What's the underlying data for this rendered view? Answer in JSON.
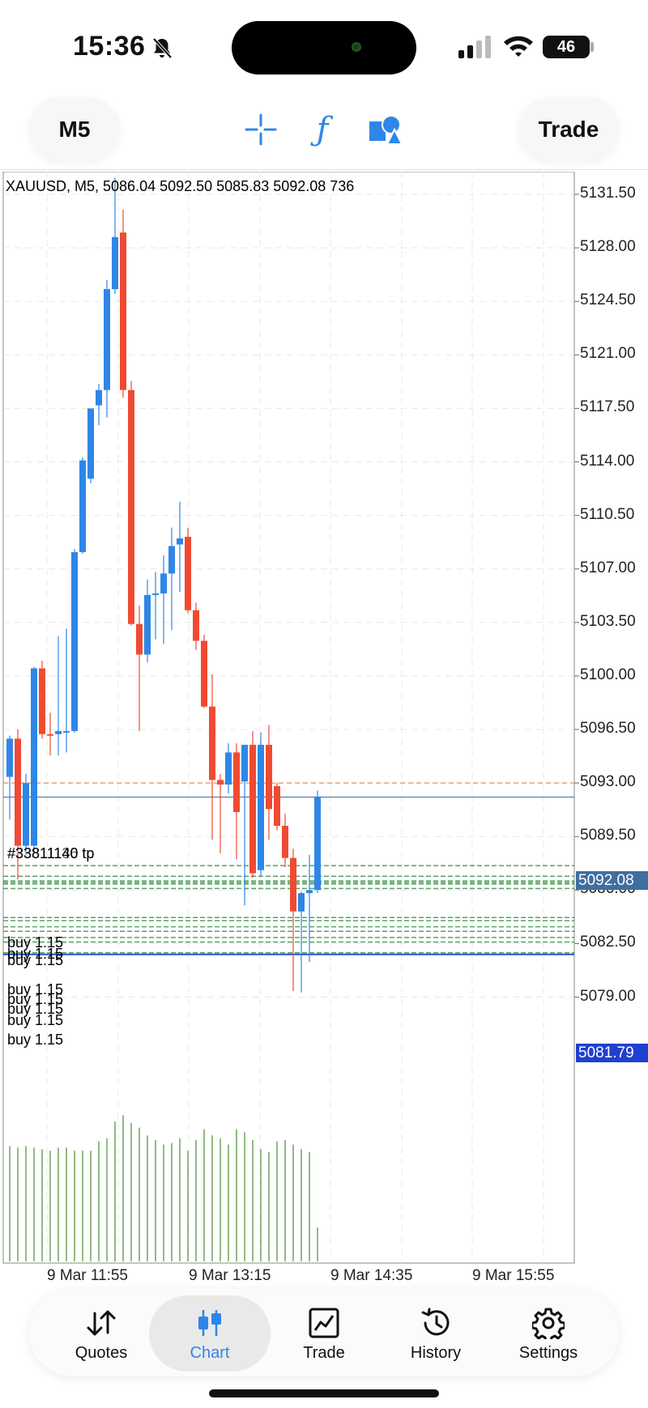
{
  "status_bar": {
    "time": "15:36",
    "battery": "46"
  },
  "toolbar": {
    "timeframe": "M5",
    "trade_label": "Trade",
    "tools": [
      "crosshair-icon",
      "function-icon",
      "objects-icon"
    ]
  },
  "chart": {
    "header": "XAUUSD, M5, 5086.04 5092.50 5085.83 5092.08 736",
    "price_axis": [
      "5131.50",
      "5128.00",
      "5124.50",
      "5121.00",
      "5117.50",
      "5114.00",
      "5110.50",
      "5107.00",
      "5103.50",
      "5100.00",
      "5096.50",
      "5093.00",
      "5089.50",
      "5086.00",
      "5082.50",
      "5079.00"
    ],
    "current_price": "5092.08",
    "low_price_tag": "5081.79",
    "time_axis": [
      "9 Mar 11:55",
      "9 Mar 13:15",
      "9 Mar 14:35",
      "9 Mar 15:55"
    ],
    "tp_label": "#33811140 tp",
    "tp_label_overlap": "#33811136 tp",
    "order_labels": [
      "buy 1.15",
      "buy 1.15",
      "buy 1.15",
      "buy 1.15",
      "buy 1.15",
      "buy 1.15",
      "buy 1.15",
      "buy 1.15"
    ],
    "colors": {
      "up": "#2f86e8",
      "down": "#f04a32",
      "volume": "#6aa65a",
      "grid": "#e8e8e8"
    }
  },
  "chart_data": {
    "type": "candlestick",
    "symbol": "XAUUSD",
    "timeframe": "M5",
    "ylim": [
      5076.5,
      5133.5
    ],
    "x": [
      "9 Mar 11:55",
      "9 Mar 13:15",
      "9 Mar 14:35",
      "9 Mar 15:55"
    ],
    "candles": [
      {
        "o": 5093.4,
        "h": 5096.1,
        "l": 5090.6,
        "c": 5095.9
      },
      {
        "o": 5095.9,
        "h": 5096.5,
        "l": 5086.7,
        "c": 5088.9
      },
      {
        "o": 5088.9,
        "h": 5093.6,
        "l": 5088.3,
        "c": 5093.0
      },
      {
        "o": 5088.9,
        "h": 5100.6,
        "l": 5088.4,
        "c": 5100.5
      },
      {
        "o": 5100.5,
        "h": 5101.0,
        "l": 5095.9,
        "c": 5096.2
      },
      {
        "o": 5096.2,
        "h": 5097.6,
        "l": 5094.8,
        "c": 5096.1
      },
      {
        "o": 5096.2,
        "h": 5102.6,
        "l": 5094.8,
        "c": 5096.4
      },
      {
        "o": 5096.4,
        "h": 5103.1,
        "l": 5095.0,
        "c": 5096.4
      },
      {
        "o": 5096.4,
        "h": 5108.3,
        "l": 5096.3,
        "c": 5108.1
      },
      {
        "o": 5108.1,
        "h": 5114.3,
        "l": 5108.0,
        "c": 5114.1
      },
      {
        "o": 5112.9,
        "h": 5117.4,
        "l": 5112.6,
        "c": 5117.5
      },
      {
        "o": 5117.7,
        "h": 5119.1,
        "l": 5116.4,
        "c": 5118.7
      },
      {
        "o": 5118.7,
        "h": 5125.9,
        "l": 5116.9,
        "c": 5125.3
      },
      {
        "o": 5125.3,
        "h": 5132.6,
        "l": 5125.0,
        "c": 5128.7
      },
      {
        "o": 5129.0,
        "h": 5130.5,
        "l": 5118.2,
        "c": 5118.7
      },
      {
        "o": 5118.7,
        "h": 5119.3,
        "l": 5103.3,
        "c": 5103.4
      },
      {
        "o": 5103.4,
        "h": 5104.6,
        "l": 5096.4,
        "c": 5101.4
      },
      {
        "o": 5101.4,
        "h": 5106.3,
        "l": 5100.9,
        "c": 5105.3
      },
      {
        "o": 5105.4,
        "h": 5106.8,
        "l": 5102.4,
        "c": 5105.4
      },
      {
        "o": 5105.4,
        "h": 5107.9,
        "l": 5102.1,
        "c": 5106.7
      },
      {
        "o": 5106.7,
        "h": 5109.7,
        "l": 5103.0,
        "c": 5108.5
      },
      {
        "o": 5108.6,
        "h": 5111.4,
        "l": 5105.5,
        "c": 5109.0
      },
      {
        "o": 5109.1,
        "h": 5109.7,
        "l": 5104.1,
        "c": 5104.3
      },
      {
        "o": 5104.3,
        "h": 5104.8,
        "l": 5101.7,
        "c": 5102.3
      },
      {
        "o": 5102.3,
        "h": 5102.7,
        "l": 5097.9,
        "c": 5098.0
      },
      {
        "o": 5098.0,
        "h": 5100.1,
        "l": 5089.3,
        "c": 5093.2
      },
      {
        "o": 5093.2,
        "h": 5093.6,
        "l": 5088.4,
        "c": 5092.9
      },
      {
        "o": 5092.9,
        "h": 5095.6,
        "l": 5092.3,
        "c": 5095.0
      },
      {
        "o": 5095.0,
        "h": 5095.6,
        "l": 5088.0,
        "c": 5091.1
      },
      {
        "o": 5093.1,
        "h": 5095.5,
        "l": 5085.0,
        "c": 5095.5
      },
      {
        "o": 5095.5,
        "h": 5096.4,
        "l": 5086.8,
        "c": 5087.1
      },
      {
        "o": 5087.3,
        "h": 5096.3,
        "l": 5086.9,
        "c": 5095.5
      },
      {
        "o": 5095.5,
        "h": 5096.8,
        "l": 5089.3,
        "c": 5091.3
      },
      {
        "o": 5092.8,
        "h": 5093.0,
        "l": 5089.9,
        "c": 5090.2
      },
      {
        "o": 5090.2,
        "h": 5091.0,
        "l": 5087.5,
        "c": 5088.1
      },
      {
        "o": 5088.1,
        "h": 5088.7,
        "l": 5079.4,
        "c": 5084.6
      },
      {
        "o": 5084.6,
        "h": 5085.9,
        "l": 5079.3,
        "c": 5085.8
      },
      {
        "o": 5085.8,
        "h": 5088.3,
        "l": 5081.3,
        "c": 5086.0
      },
      {
        "o": 5086.0,
        "h": 5092.5,
        "l": 5085.8,
        "c": 5092.1
      }
    ],
    "volume_relative": [
      0.75,
      0.74,
      0.75,
      0.74,
      0.73,
      0.72,
      0.74,
      0.74,
      0.72,
      0.72,
      0.72,
      0.78,
      0.8,
      0.91,
      0.95,
      0.9,
      0.87,
      0.82,
      0.79,
      0.76,
      0.77,
      0.8,
      0.72,
      0.79,
      0.86,
      0.82,
      0.8,
      0.76,
      0.86,
      0.84,
      0.79,
      0.73,
      0.71,
      0.78,
      0.79,
      0.76,
      0.73,
      0.71,
      0.22
    ],
    "levels": {
      "tp": 5093.0,
      "bid": 5092.08,
      "buy_orders": [
        5087.6,
        5086.9,
        5086.6,
        5086.5,
        5086.4,
        5086.1,
        5084.2,
        5084.0,
        5083.6,
        5083.3,
        5082.9,
        5082.6,
        5081.9,
        5081.79
      ]
    }
  },
  "tabs": [
    {
      "label": "Quotes",
      "icon": "arrows-updown-icon"
    },
    {
      "label": "Chart",
      "icon": "candles-icon",
      "active": true
    },
    {
      "label": "Trade",
      "icon": "trade-chart-icon"
    },
    {
      "label": "History",
      "icon": "history-icon"
    },
    {
      "label": "Settings",
      "icon": "gear-icon"
    }
  ]
}
